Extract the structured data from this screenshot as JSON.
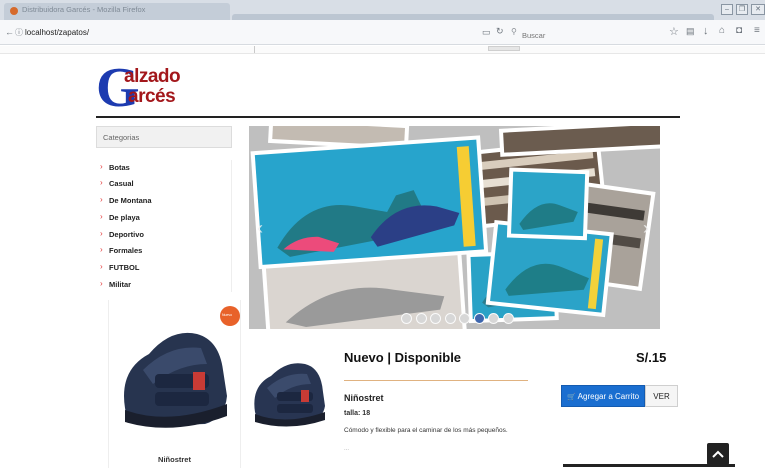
{
  "browser": {
    "window_title": "Distribuidora Garcés - Mozilla Firefox",
    "url": "localhost/zapatos/",
    "search_placeholder": "Buscar"
  },
  "logo": {
    "initial": "G",
    "word1": "alzado",
    "word2": "arcés"
  },
  "sidebar": {
    "header": "Categorias",
    "items": [
      {
        "label": "Botas"
      },
      {
        "label": "Casual"
      },
      {
        "label": "De Montana"
      },
      {
        "label": "De playa"
      },
      {
        "label": "Deportivo"
      },
      {
        "label": "Formales"
      },
      {
        "label": "FUTBOL"
      },
      {
        "label": "Militar"
      }
    ]
  },
  "carousel": {
    "slide_count": 8,
    "active_index": 5
  },
  "product_card": {
    "name": "Niñostret",
    "badge": "Nuevo"
  },
  "product_detail": {
    "heading": "Nuevo | Disponible",
    "price": "S/.15",
    "name": "Niñostret",
    "talla_label": "talla:",
    "talla_value": "18",
    "description": "Cómodo y flexible para el caminar de los más pequeños.",
    "ellipsis": "...",
    "cart_button": "Agregar a Carrito",
    "view_button": "VER"
  },
  "colors": {
    "accent_blue": "#1a6ed0",
    "logo_blue": "#1d3bb0",
    "logo_red": "#a3171b",
    "category_chevron": "#e23a3a",
    "badge_orange": "#e8622a"
  }
}
